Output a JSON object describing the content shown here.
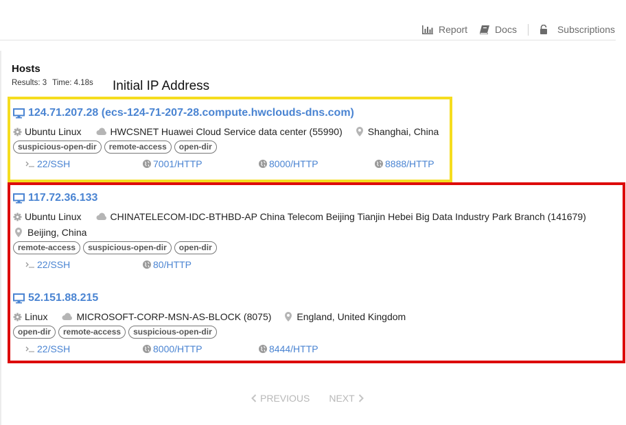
{
  "nav": {
    "report": "Report",
    "docs": "Docs",
    "subscriptions": "Subscriptions"
  },
  "page": {
    "title": "Hosts",
    "results_label": "Results: 3",
    "time_label": "Time: 4.18s",
    "annotation": "Initial IP Address"
  },
  "hosts": [
    {
      "title": "124.71.207.28 (ecs-124-71-207-28.compute.hwclouds-dns.com)",
      "os": "Ubuntu Linux",
      "network": "HWCSNET Huawei Cloud Service data center (55990)",
      "location": "Shanghai, China",
      "tags": [
        "suspicious-open-dir",
        "remote-access",
        "open-dir"
      ],
      "ports": [
        "22/SSH",
        "7001/HTTP",
        "8000/HTTP",
        "8888/HTTP"
      ]
    },
    {
      "title": "117.72.36.133",
      "os": "Ubuntu Linux",
      "network": "CHINATELECOM-IDC-BTHBD-AP China Telecom Beijing Tianjin Hebei Big Data Industry Park Branch (141679)",
      "location": "Beijing, China",
      "tags": [
        "remote-access",
        "suspicious-open-dir",
        "open-dir"
      ],
      "ports": [
        "22/SSH",
        "80/HTTP"
      ]
    },
    {
      "title": "52.151.88.215",
      "os": "Linux",
      "network": "MICROSOFT-CORP-MSN-AS-BLOCK (8075)",
      "location": "England, United Kingdom",
      "tags": [
        "open-dir",
        "remote-access",
        "suspicious-open-dir"
      ],
      "ports": [
        "22/SSH",
        "8000/HTTP",
        "8444/HTTP"
      ]
    }
  ],
  "pagination": {
    "previous": "PREVIOUS",
    "next": "NEXT"
  },
  "colors": {
    "link": "#4a84d2",
    "highlight_yellow": "#f5dd1f",
    "highlight_red": "#dd0b0b"
  },
  "icons": {
    "report": "bar-chart-icon",
    "docs": "book-icon",
    "subscriptions": "lock-icon",
    "host": "desktop-icon",
    "os": "gear-icon",
    "network": "cloud-icon",
    "location": "map-pin-icon",
    "ssh": "terminal-icon",
    "http": "globe-icon"
  }
}
